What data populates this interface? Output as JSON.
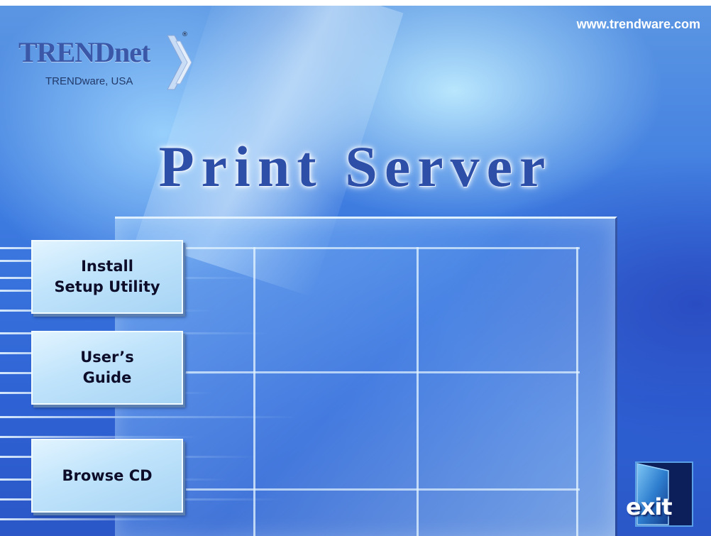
{
  "header": {
    "logo_name": "TRENDnet",
    "logo_registered": "®",
    "logo_subtitle": "TRENDware, USA",
    "url": "www.trendware.com"
  },
  "main": {
    "title": "Print Server"
  },
  "menu": [
    {
      "label": "Install\nSetup Utility"
    },
    {
      "label": "User’s\nGuide"
    },
    {
      "label": "Browse CD"
    }
  ],
  "exit": {
    "label": "exit",
    "icon": "exit-door-icon"
  },
  "colors": {
    "background": "#3d7be0",
    "title": "#2e4fa8",
    "logo": "#3a57a8",
    "button": "#bfe3fb"
  }
}
